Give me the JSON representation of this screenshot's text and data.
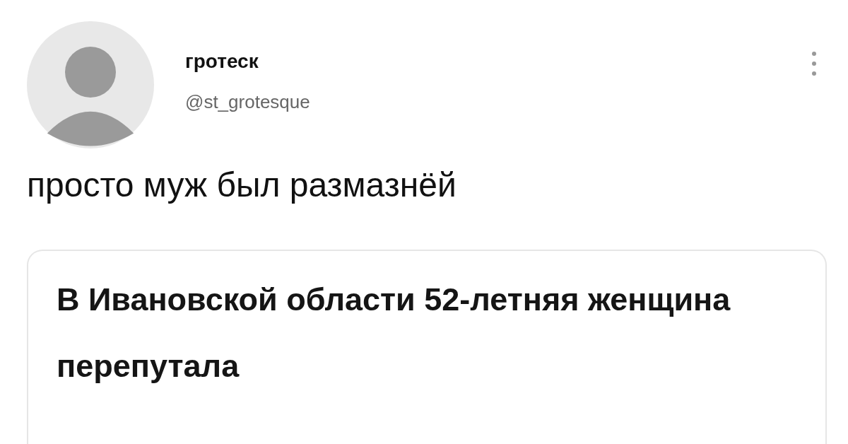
{
  "author": {
    "name": "гротеск",
    "handle": "@st_grotesque"
  },
  "tweet_text": "просто муж был размазнёй",
  "card": {
    "headline": "В Ивановской области 52-летняя женщина перепутала"
  }
}
